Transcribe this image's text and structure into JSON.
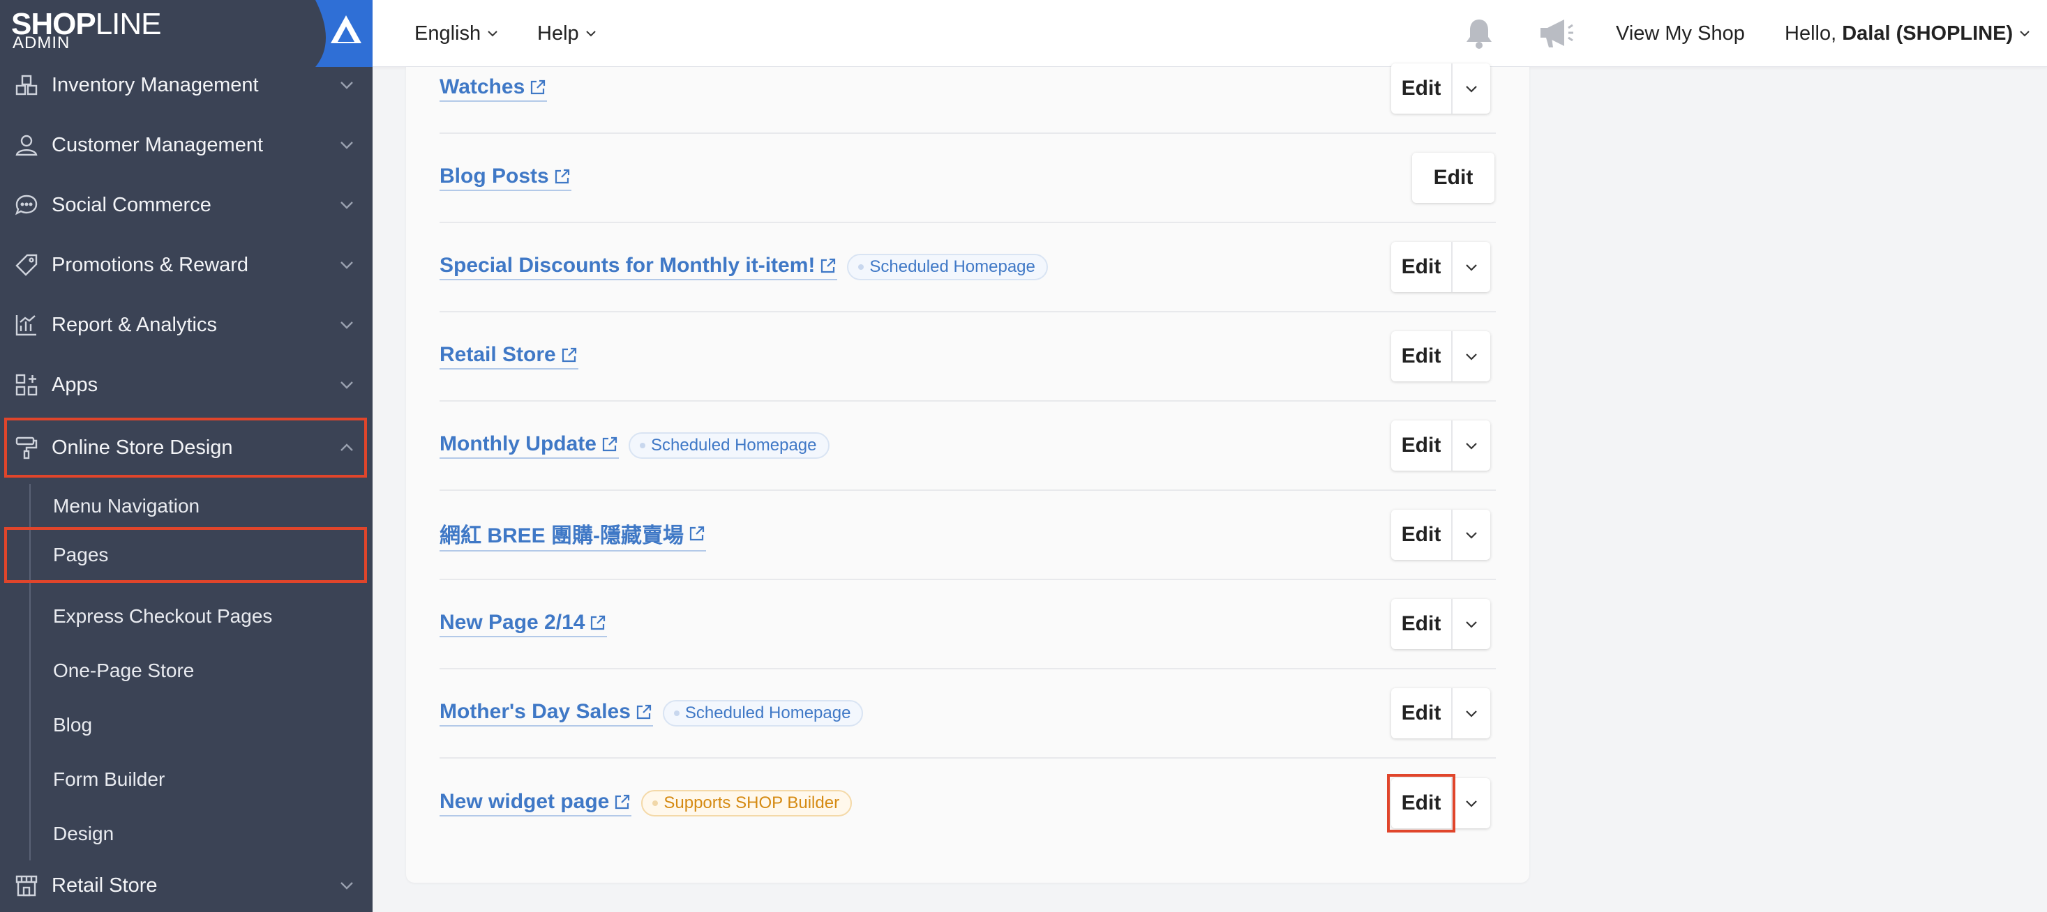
{
  "brand": {
    "name_bold": "SHOP",
    "name_light": "LINE",
    "sub": "ADMIN"
  },
  "sidebar": {
    "items": [
      {
        "label": "Inventory Management",
        "icon": "boxes-icon"
      },
      {
        "label": "Customer Management",
        "icon": "person-icon"
      },
      {
        "label": "Social Commerce",
        "icon": "chat-bubble-icon"
      },
      {
        "label": "Promotions & Reward",
        "icon": "tag-icon"
      },
      {
        "label": "Report & Analytics",
        "icon": "bar-chart-icon"
      },
      {
        "label": "Apps",
        "icon": "grid-icon"
      },
      {
        "label": "Online Store Design",
        "icon": "paint-roller-icon"
      },
      {
        "label": "Retail Store",
        "icon": "storefront-icon"
      }
    ],
    "submenu": [
      {
        "label": "Menu Navigation"
      },
      {
        "label": "Pages"
      },
      {
        "label": "Express Checkout Pages"
      },
      {
        "label": "One-Page Store"
      },
      {
        "label": "Blog"
      },
      {
        "label": "Form Builder"
      },
      {
        "label": "Design"
      }
    ]
  },
  "topbar": {
    "language": "English",
    "help": "Help",
    "view_shop": "View My Shop",
    "greeting": "Hello, ",
    "user": "Dalal (SHOPLINE)"
  },
  "pages": [
    {
      "title": "Watches",
      "badge": ""
    },
    {
      "title": "Blog Posts",
      "badge": ""
    },
    {
      "title": "Special Discounts for Monthly it-item!",
      "badge": "Scheduled Homepage"
    },
    {
      "title": "Retail Store",
      "badge": ""
    },
    {
      "title": "Monthly Update",
      "badge": "Scheduled Homepage"
    },
    {
      "title": "網紅 BREE 團購-隱藏賣場",
      "badge": ""
    },
    {
      "title": "New Page 2/14",
      "badge": ""
    },
    {
      "title": "Mother's Day Sales",
      "badge": "Scheduled Homepage"
    },
    {
      "title": "New widget page",
      "badge": "Supports SHOP Builder"
    }
  ],
  "buttons": {
    "edit": "Edit"
  },
  "colors": {
    "sidebar_bg": "#3b4355",
    "link": "#3f78c6",
    "highlight": "#e0452b",
    "builder_badge": "#d58a12"
  }
}
